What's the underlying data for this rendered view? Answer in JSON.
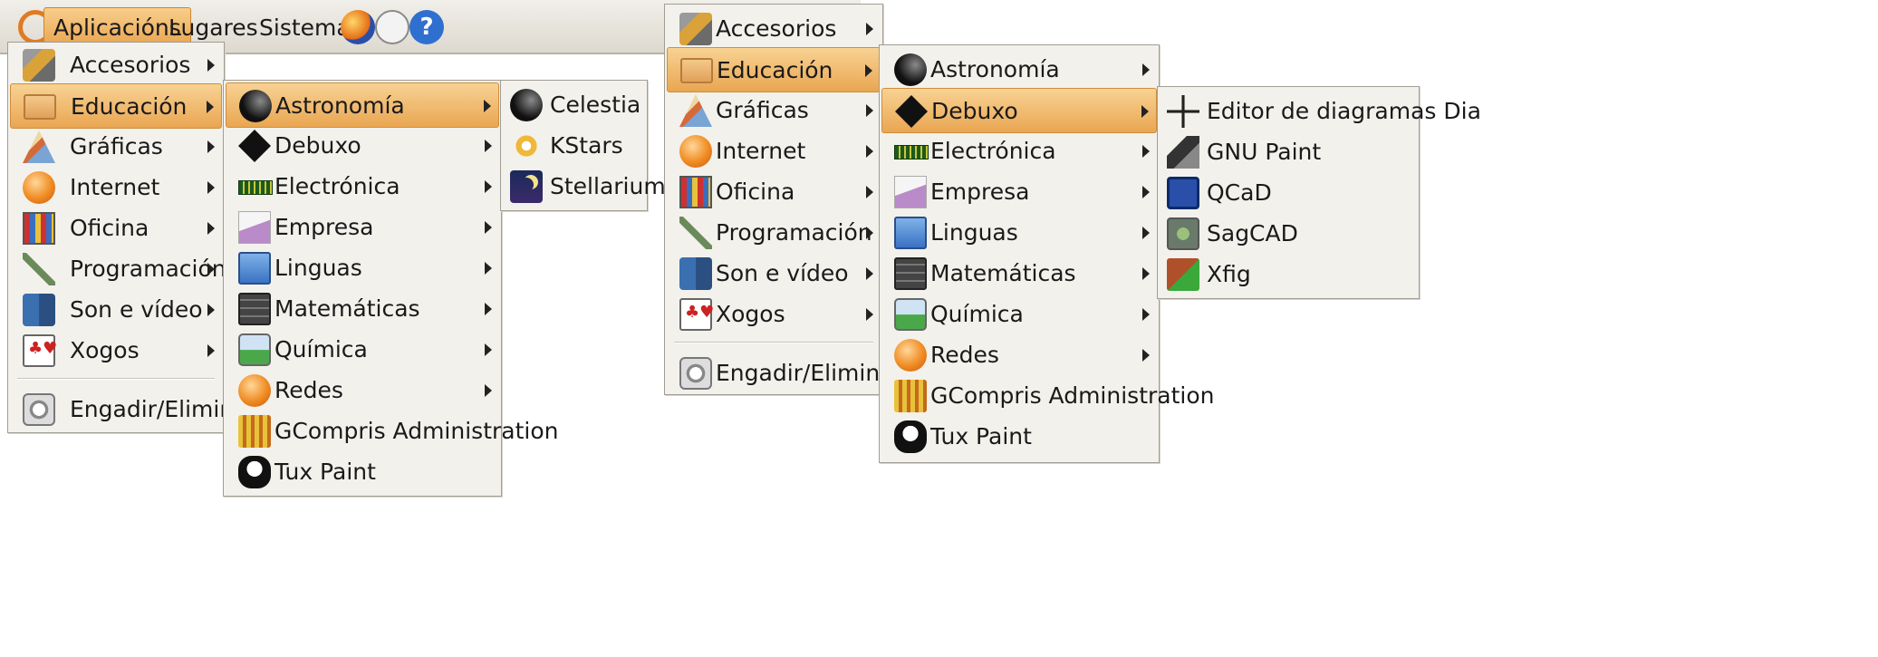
{
  "colors": {
    "menu_bg": "#f3f1ec",
    "highlight": "#e9a652",
    "border": "#a19d94",
    "panel": "#ddd9cf"
  },
  "panel": {
    "applications": "Aplicacións",
    "places": "Lugares",
    "system": "Sistema",
    "icons": [
      "ubuntu-logo-icon",
      "firefox-icon",
      "mail-icon",
      "help-icon"
    ],
    "help_glyph": "?"
  },
  "left": {
    "main_menu": [
      {
        "label": "Accesorios",
        "icon": "accessories-icon"
      },
      {
        "label": "Educación",
        "icon": "education-folder-icon"
      },
      {
        "label": "Gráficas",
        "icon": "graphics-icon"
      },
      {
        "label": "Internet",
        "icon": "internet-icon"
      },
      {
        "label": "Oficina",
        "icon": "office-icon"
      },
      {
        "label": "Programación",
        "icon": "programming-icon"
      },
      {
        "label": "Son e vídeo",
        "icon": "sound-video-icon"
      },
      {
        "label": "Xogos",
        "icon": "games-icon"
      },
      {
        "label": "Engadir/Eliminar...",
        "icon": "add-remove-icon"
      }
    ],
    "edu_menu": [
      {
        "label": "Astronomía",
        "icon": "astronomy-icon"
      },
      {
        "label": "Debuxo",
        "icon": "drawing-icon"
      },
      {
        "label": "Electrónica",
        "icon": "electronics-icon"
      },
      {
        "label": "Empresa",
        "icon": "business-icon"
      },
      {
        "label": "Linguas",
        "icon": "languages-icon"
      },
      {
        "label": "Matemáticas",
        "icon": "math-icon"
      },
      {
        "label": "Química",
        "icon": "chemistry-icon"
      },
      {
        "label": "Redes",
        "icon": "networks-icon"
      },
      {
        "label": "GCompris Administration",
        "icon": "gcompris-icon"
      },
      {
        "label": "Tux Paint",
        "icon": "tux-paint-icon"
      }
    ],
    "astro_menu": [
      {
        "label": "Celestia",
        "icon": "celestia-icon"
      },
      {
        "label": "KStars",
        "icon": "kstars-icon"
      },
      {
        "label": "Stellarium",
        "icon": "stellarium-icon"
      }
    ]
  },
  "right": {
    "main_menu": [
      {
        "label": "Accesorios"
      },
      {
        "label": "Educación"
      },
      {
        "label": "Gráficas"
      },
      {
        "label": "Internet"
      },
      {
        "label": "Oficina"
      },
      {
        "label": "Programación"
      },
      {
        "label": "Son e vídeo"
      },
      {
        "label": "Xogos"
      },
      {
        "label": "Engadir/Eliminar..."
      }
    ],
    "edu_menu": [
      {
        "label": "Astronomía"
      },
      {
        "label": "Debuxo"
      },
      {
        "label": "Electrónica"
      },
      {
        "label": "Empresa"
      },
      {
        "label": "Linguas"
      },
      {
        "label": "Matemáticas"
      },
      {
        "label": "Química"
      },
      {
        "label": "Redes"
      },
      {
        "label": "GCompris Administration"
      },
      {
        "label": "Tux Paint"
      }
    ],
    "debuxo_menu": [
      {
        "label": "Editor de diagramas Dia",
        "icon": "dia-icon"
      },
      {
        "label": "GNU Paint",
        "icon": "gnu-paint-icon"
      },
      {
        "label": "QCaD",
        "icon": "qcad-icon"
      },
      {
        "label": "SagCAD",
        "icon": "sagcad-icon"
      },
      {
        "label": "Xfig",
        "icon": "xfig-icon"
      }
    ]
  }
}
